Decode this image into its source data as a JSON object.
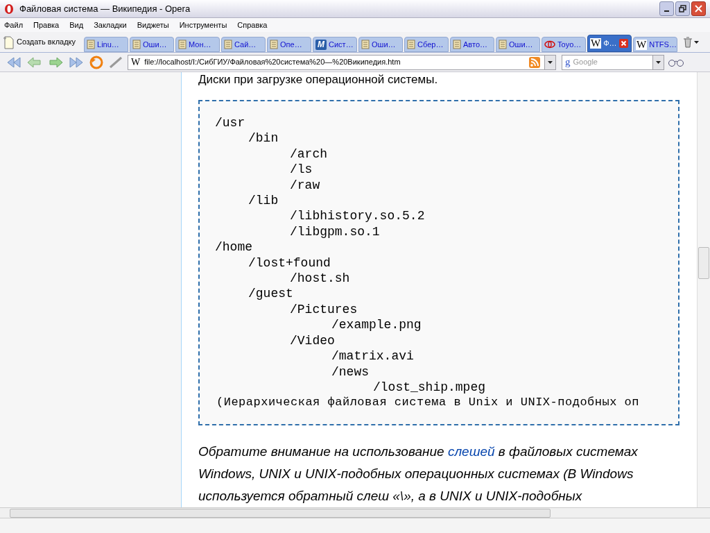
{
  "window": {
    "title": "Файловая система — Википедия - Opera"
  },
  "menu": [
    "Файл",
    "Правка",
    "Вид",
    "Закладки",
    "Виджеты",
    "Инструменты",
    "Справка"
  ],
  "new_tab": "Создать вкладку",
  "tabs": [
    {
      "kind": "page",
      "label": "Linu…",
      "selected": false
    },
    {
      "kind": "page",
      "label": "Оши…",
      "selected": false
    },
    {
      "kind": "page",
      "label": "Мон…",
      "selected": false
    },
    {
      "kind": "page",
      "label": "Сай…",
      "selected": false
    },
    {
      "kind": "page",
      "label": "Опе…",
      "selected": false
    },
    {
      "kind": "letter",
      "logo": "M",
      "label": "Сист…",
      "selected": false
    },
    {
      "kind": "page",
      "label": "Оши…",
      "selected": false
    },
    {
      "kind": "page",
      "label": "Сбер…",
      "selected": false
    },
    {
      "kind": "page",
      "label": "Авто…",
      "selected": false
    },
    {
      "kind": "page",
      "label": "Оши…",
      "selected": false
    },
    {
      "kind": "emblem",
      "label": "Toyo…",
      "selected": false
    },
    {
      "kind": "wiki",
      "logo": "W",
      "label": "Ф…",
      "selected": true
    },
    {
      "kind": "wiki",
      "logo": "W",
      "label": "NTFS…",
      "selected": false
    }
  ],
  "address": {
    "logo": "W",
    "url": "file://localhost/I:/СибГИУ/Файловая%20система%20—%20Википедия.htm"
  },
  "search": {
    "logo": "g",
    "placeholder": "Google"
  },
  "content": {
    "intro": "Диски при загрузке операционной системы.",
    "tree": [
      {
        "name": "/usr",
        "children": [
          {
            "name": "/bin",
            "children": [
              {
                "name": "/arch"
              },
              {
                "name": "/ls"
              },
              {
                "name": "/raw"
              }
            ]
          },
          {
            "name": "/lib",
            "children": [
              {
                "name": "/libhistory.so.5.2"
              },
              {
                "name": "/libgpm.so.1"
              }
            ]
          }
        ]
      },
      {
        "name": "/home",
        "children": [
          {
            "name": "/lost+found",
            "children": [
              {
                "name": "/host.sh"
              }
            ]
          },
          {
            "name": "/guest",
            "children": [
              {
                "name": "/Pictures",
                "children": [
                  {
                    "name": "/example.png"
                  }
                ]
              },
              {
                "name": "/Video",
                "children": [
                  {
                    "name": "/matrix.avi"
                  },
                  {
                    "name": "/news",
                    "children": [
                      {
                        "name": "/lost_ship.mpeg"
                      }
                    ]
                  }
                ]
              }
            ]
          }
        ]
      }
    ],
    "caption": "(Иерархическая файловая система в Unix и UNIX-подобных оп",
    "paragraph": {
      "before": "Обратите внимание на использование ",
      "link": "слешей",
      "after": " в файловых системах Windows, UNIX и UNIX-подобных операционных системах (В Windows используется обратный слеш «\\», а в UNIX и UNIX-подобных"
    }
  }
}
